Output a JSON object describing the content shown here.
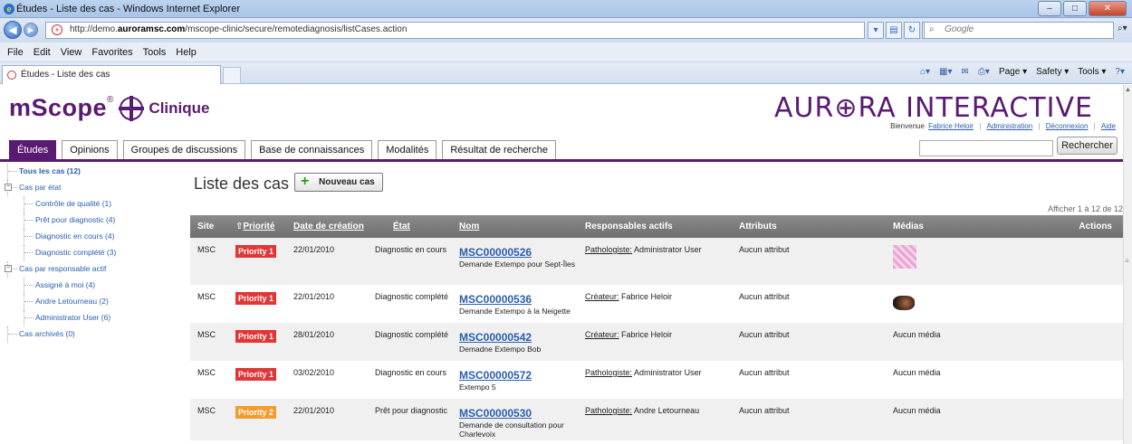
{
  "browser": {
    "title": "Études - Liste des cas - Windows Internet Explorer",
    "url_prefix": "http://demo.",
    "url_domain": "auroramsc.com",
    "url_path": "/mscope-clinic/secure/remotediagnosis/listCases.action",
    "search_placeholder": "Google",
    "menu": [
      "File",
      "Edit",
      "View",
      "Favorites",
      "Tools",
      "Help"
    ],
    "tab_label": "Études - Liste des cas",
    "commands": {
      "page": "Page ▾",
      "safety": "Safety ▾",
      "tools": "Tools ▾"
    }
  },
  "header": {
    "logo_text": "mScope",
    "logo_reg": "®",
    "logo_sub": "Clinique",
    "brand_a": "AUR",
    "brand_b": "RA INTERACTIVE",
    "welcome": "Bienvenue",
    "user": "Fabrice Heloir",
    "links": [
      "Administration",
      "Déconnexion",
      "Aide"
    ],
    "search_button": "Rechercher"
  },
  "tabs": [
    "Études",
    "Opinions",
    "Groupes de discussions",
    "Base de connaissances",
    "Modalités",
    "Résultat de recherche"
  ],
  "tree": [
    {
      "label": "Tous les cas (12)",
      "level": 0,
      "selected": true
    },
    {
      "label": "Cas par état",
      "level": 0,
      "expander": "−"
    },
    {
      "label": "Contrôle de qualité (1)",
      "level": 1
    },
    {
      "label": "Prêt pour diagnostic (4)",
      "level": 1
    },
    {
      "label": "Diagnostic en cours (4)",
      "level": 1
    },
    {
      "label": "Diagnostic complété (3)",
      "level": 1
    },
    {
      "label": "Cas par responsable actif",
      "level": 0,
      "expander": "−"
    },
    {
      "label": "Assigné à moi (4)",
      "level": 1
    },
    {
      "label": "Andre Letourneau (2)",
      "level": 1
    },
    {
      "label": "Administrator User (6)",
      "level": 1
    },
    {
      "label": "Cas archivés (0)",
      "level": 0
    }
  ],
  "content": {
    "title": "Liste des cas",
    "new_button": "Nouveau cas",
    "showing": "Afficher 1 à 12 de 12"
  },
  "columns": {
    "site": "Site",
    "priority": "Priorité",
    "date": "Date de création",
    "state": "État",
    "name": "Nom",
    "resp": "Responsables actifs",
    "attr": "Attributs",
    "media": "Médias",
    "actions": "Actions"
  },
  "rows": [
    {
      "site": "MSC",
      "priority": "Priority 1",
      "pclass": "p1",
      "date": "22/01/2010",
      "state": "Diagnostic en cours",
      "id": "MSC00000526",
      "desc": "Demande Extempo pour Sept-Îles",
      "resp_role": "Pathologiste:",
      "resp_name": " Administrator User",
      "attr": "Aucun attribut",
      "media": "",
      "thumb": "slide"
    },
    {
      "site": "MSC",
      "priority": "Priority 1",
      "pclass": "p1",
      "date": "22/01/2010",
      "state": "Diagnostic complété",
      "id": "MSC00000536",
      "desc": "Demande Extempo à la Neigette",
      "resp_role": "Créateur:",
      "resp_name": " Fabrice Heloir",
      "attr": "Aucun attribut",
      "media": "",
      "thumb": "photo"
    },
    {
      "site": "MSC",
      "priority": "Priority 1",
      "pclass": "p1",
      "date": "28/01/2010",
      "state": "Diagnostic complété",
      "id": "MSC00000542",
      "desc": "Demadne Extempo Bob",
      "resp_role": "Créateur:",
      "resp_name": " Fabrice Heloir",
      "attr": "Aucun attribut",
      "media": "Aucun média",
      "thumb": ""
    },
    {
      "site": "MSC",
      "priority": "Priority 1",
      "pclass": "p1",
      "date": "03/02/2010",
      "state": "Diagnostic en cours",
      "id": "MSC00000572",
      "desc": "Extempo 5",
      "resp_role": "Pathologiste:",
      "resp_name": " Administrator User",
      "attr": "Aucun attribut",
      "media": "Aucun média",
      "thumb": ""
    },
    {
      "site": "MSC",
      "priority": "Priority 2",
      "pclass": "p2",
      "date": "22/01/2010",
      "state": "Prêt pour diagnostic",
      "id": "MSC00000530",
      "desc": "Demande de consultation pour Charlevoix",
      "resp_role": "Pathologiste:",
      "resp_name": " Andre Letourneau",
      "attr": "Aucun attribut",
      "media": "Aucun média",
      "thumb": ""
    }
  ],
  "colors": {
    "brand": "#5a1a72",
    "priority1": "#e03636",
    "priority2": "#f39b2f",
    "link": "#2a5db0"
  }
}
